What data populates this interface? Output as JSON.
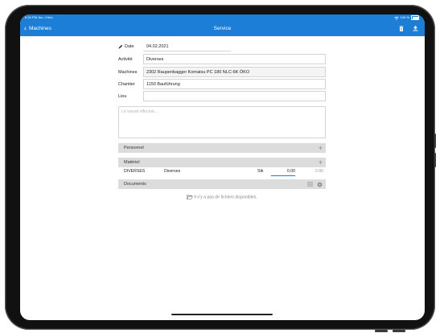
{
  "status_bar": {
    "time_date": "6:34 PM  Jeu. 4 févr.",
    "battery": "100 %"
  },
  "nav": {
    "back_label": "Machines",
    "title": "Service"
  },
  "form": {
    "date_label": "Date",
    "date_value": "04.02.2021",
    "activity_label": "Activité",
    "activity_value": "Diverses",
    "machines_label": "Machines",
    "machines_value": "2302 Raupenbagger Komatsu PC 180 NLC-6K ÖKO",
    "site_label": "Chantier",
    "site_value": "1150 Bauführung",
    "place_label": "Lieu",
    "place_value": "",
    "work_placeholder": "Le travail effectué..."
  },
  "sections": {
    "personnel": "Personnel",
    "materiel": "Matériel",
    "documents": "Documents"
  },
  "material_rows": [
    {
      "code": "DIVERSES",
      "name": "Diverses",
      "unit": "Stk",
      "quantity": "0.00",
      "total": "0.00"
    }
  ],
  "documents_empty": "Il n'y a pas de fichiers disponibles.",
  "colors": {
    "accent": "#1c7ed6",
    "section_bg": "#dcdcdc"
  }
}
